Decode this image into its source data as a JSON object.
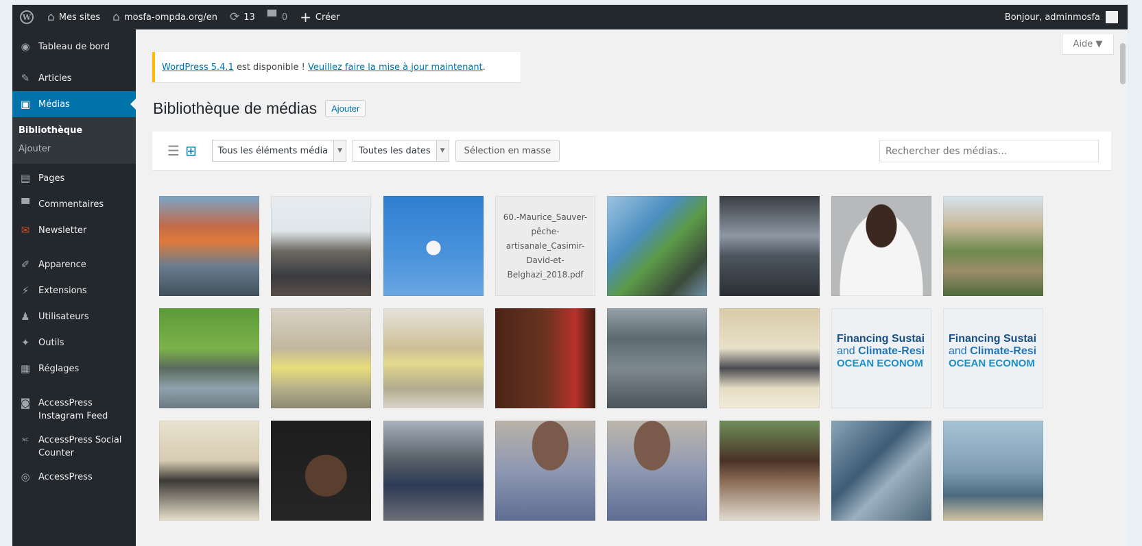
{
  "adminbar": {
    "wp_logo": "W",
    "my_sites": "Mes sites",
    "site": "mosfa-ompda.org/en",
    "updates_count": "13",
    "comments_count": "0",
    "new": "Créer",
    "greeting": "Bonjour, adminmosfa",
    "icons": {
      "my_sites": "sites-icon",
      "site": "home-icon",
      "updates": "refresh-icon",
      "comments": "comment-icon",
      "new": "plus-icon"
    }
  },
  "sidebar": {
    "items": [
      {
        "label": "Tableau de bord",
        "icon": "dashboard-icon"
      },
      {
        "label": "Articles",
        "icon": "pin-icon"
      },
      {
        "label": "Médias",
        "icon": "media-icon",
        "active": true
      },
      {
        "label": "Pages",
        "icon": "page-icon"
      },
      {
        "label": "Commentaires",
        "icon": "comment-icon"
      },
      {
        "label": "Newsletter",
        "icon": "newsletter-icon"
      },
      {
        "label": "Apparence",
        "icon": "brush-icon"
      },
      {
        "label": "Extensions",
        "icon": "plugin-icon"
      },
      {
        "label": "Utilisateurs",
        "icon": "users-icon"
      },
      {
        "label": "Outils",
        "icon": "wrench-icon"
      },
      {
        "label": "Réglages",
        "icon": "settings-icon"
      },
      {
        "label": "AccessPress Instagram Feed",
        "icon": "instagram-icon"
      },
      {
        "label": "AccessPress Social Counter",
        "icon": "sc-icon"
      },
      {
        "label": "AccessPress",
        "icon": "accesspress-icon"
      }
    ],
    "submenu": {
      "library": "Bibliothèque",
      "add": "Ajouter"
    }
  },
  "help_tab": "Aide ▼",
  "notice": {
    "version_link": "WordPress 5.4.1",
    "middle": " est disponible ! ",
    "update_link": "Veuillez faire la mise à jour maintenant",
    "end": "."
  },
  "page": {
    "title": "Bibliothèque de médias",
    "add_button": "Ajouter"
  },
  "toolbar": {
    "filter_type": "Tous les éléments média",
    "filter_date": "Toutes les dates",
    "bulk_select": "Sélection en masse",
    "search_placeholder": "Rechercher des médias..."
  },
  "doc_tile": {
    "filename": "60.-Maurice_Sauver-pêche-artisanale_Casimir-David-et-Belghazi_2018.pdf"
  },
  "ocean_tile": {
    "line1": "Financing Sustai",
    "line2_a": "and ",
    "line2_b": "Climate-Resi",
    "line3": "OCEAN ECONOM"
  },
  "colors": {
    "admin_bar": "#23282d",
    "accent": "#0073aa",
    "notice": "#ffb900"
  }
}
